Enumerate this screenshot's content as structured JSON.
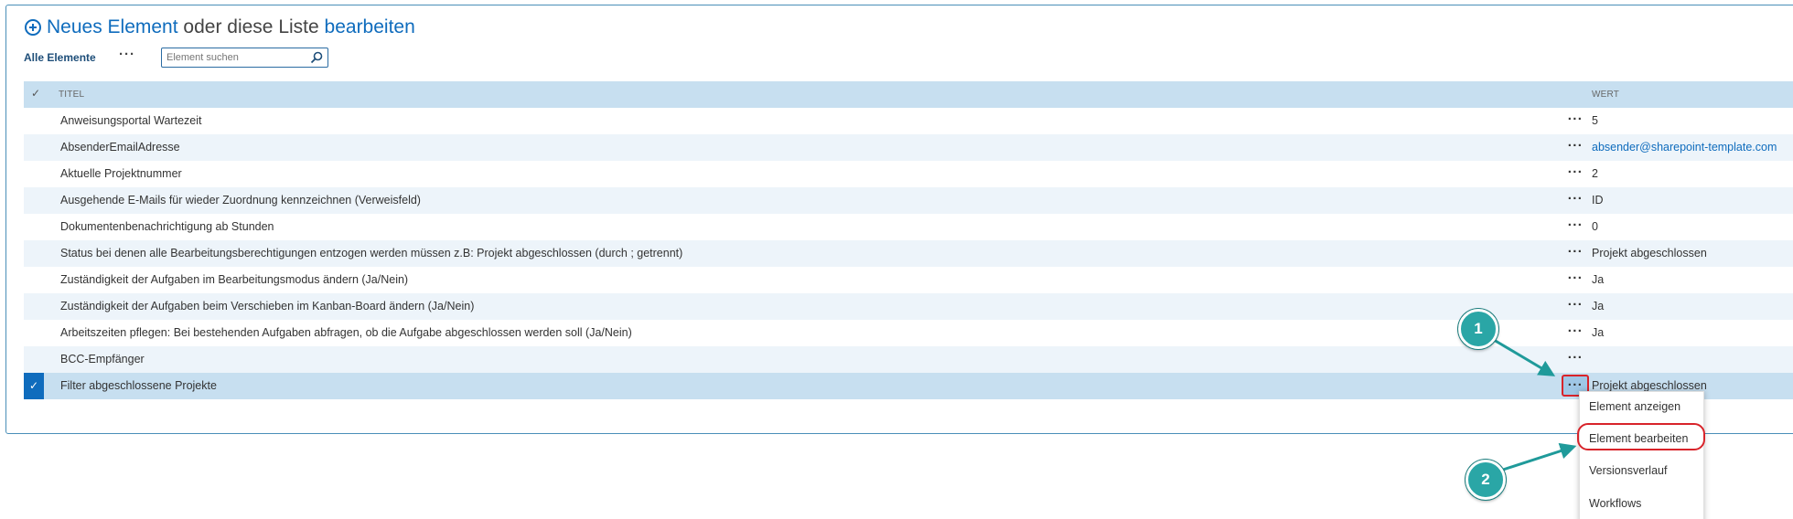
{
  "header": {
    "title_part1": "Neues Element",
    "title_part2": "oder diese Liste",
    "title_part3": "bearbeiten"
  },
  "viewbar": {
    "view_label": "Alle Elemente",
    "more_label": "···",
    "search_placeholder": "Element suchen"
  },
  "list": {
    "columns": {
      "check": "✓",
      "title": "TITEL",
      "value": "WERT"
    },
    "more_label": "···",
    "rows": [
      {
        "title": "Anweisungsportal Wartezeit",
        "value": "5"
      },
      {
        "title": "AbsenderEmailAdresse",
        "value": "absender@sharepoint-template.com"
      },
      {
        "title": "Aktuelle Projektnummer",
        "value": "2"
      },
      {
        "title": "Ausgehende E-Mails für wieder Zuordnung kennzeichnen (Verweisfeld)",
        "value": "ID"
      },
      {
        "title": "Dokumentenbenachrichtigung ab Stunden",
        "value": "0"
      },
      {
        "title": "Status bei denen alle Bearbeitungsberechtigungen entzogen werden müssen z.B: Projekt abgeschlossen (durch ; getrennt)",
        "value": "Projekt abgeschlossen"
      },
      {
        "title": "Zuständigkeit der Aufgaben im Bearbeitungsmodus ändern (Ja/Nein)",
        "value": "Ja"
      },
      {
        "title": "Zuständigkeit der Aufgaben beim Verschieben im Kanban-Board ändern (Ja/Nein)",
        "value": "Ja"
      },
      {
        "title": "Arbeitszeiten pflegen: Bei bestehenden Aufgaben abfragen, ob die Aufgabe abgeschlossen werden soll (Ja/Nein)",
        "value": "Ja"
      },
      {
        "title": "BCC-Empfänger",
        "value": ""
      },
      {
        "title": "Filter abgeschlossene Projekte",
        "value": "Projekt abgeschlossen",
        "selected_mark": "✓"
      }
    ]
  },
  "context_menu": {
    "items": [
      "Element anzeigen",
      "Element bearbeiten",
      "Versionsverlauf",
      "Workflows"
    ]
  },
  "callouts": {
    "one": "1",
    "two": "2"
  },
  "colors": {
    "accent": "#0f6cbd",
    "header_bg": "#c7dff0",
    "alt_row_bg": "#edf4fa",
    "highlight_red": "#d8232a",
    "callout_teal": "#2aa6a6"
  }
}
